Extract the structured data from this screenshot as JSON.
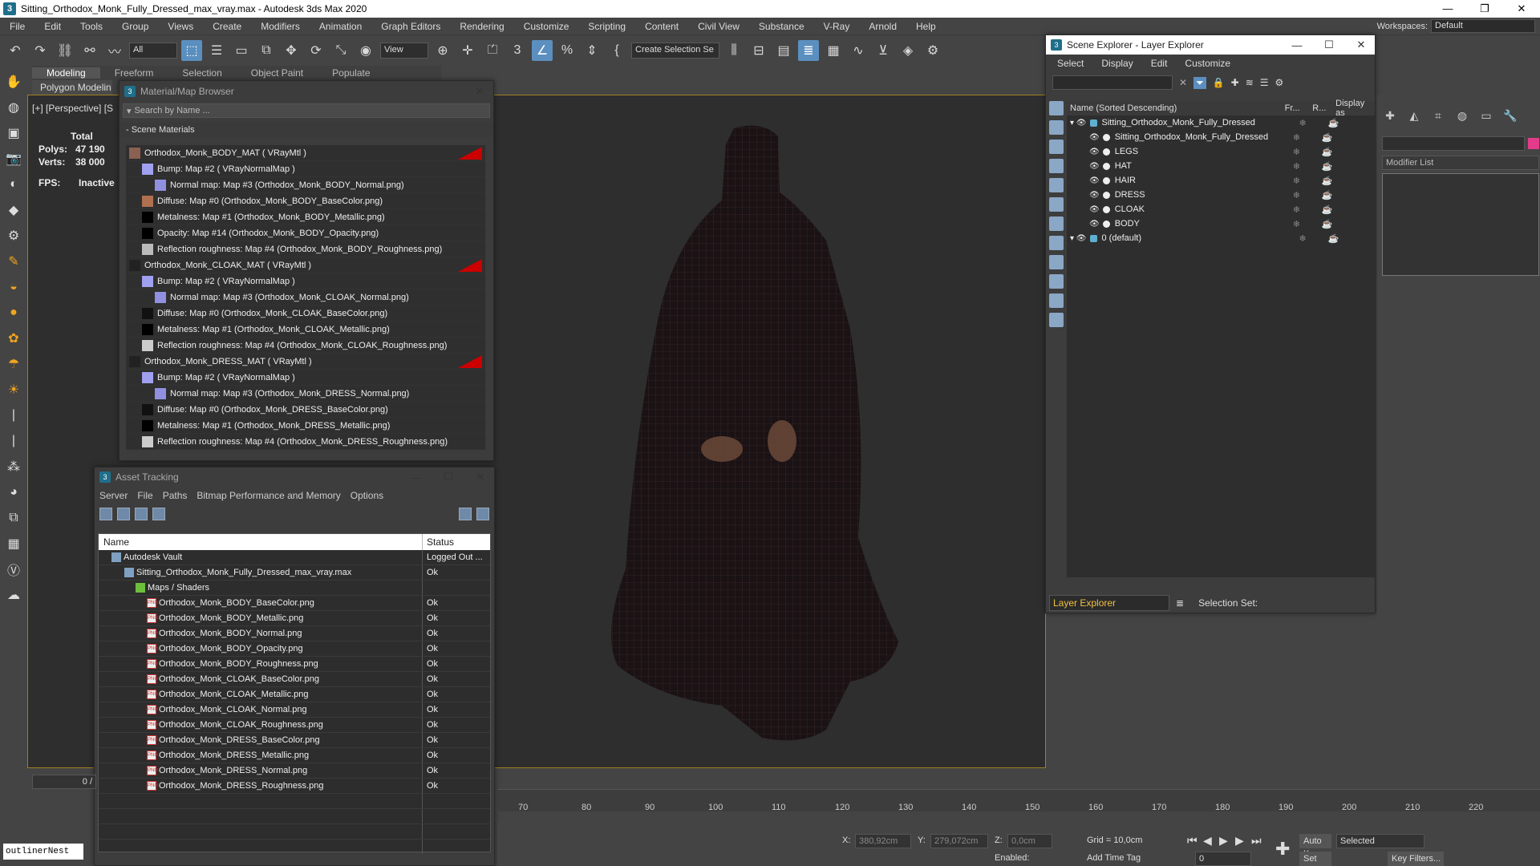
{
  "window": {
    "title": "Sitting_Orthodox_Monk_Fully_Dressed_max_vray.max - Autodesk 3ds Max 2020",
    "minimize": "—",
    "restore": "❐",
    "close": "✕"
  },
  "menu": [
    "File",
    "Edit",
    "Tools",
    "Group",
    "Views",
    "Create",
    "Modifiers",
    "Animation",
    "Graph Editors",
    "Rendering",
    "Customize",
    "Scripting",
    "Content",
    "Civil View",
    "Substance",
    "V-Ray",
    "Arnold",
    "Help"
  ],
  "workspaces": {
    "label": "Workspaces:",
    "value": "Default"
  },
  "toolbar": {
    "filter": "All",
    "view": "View",
    "selection_set": "Create Selection Se"
  },
  "ribbon": {
    "tabs": [
      "Modeling",
      "Freeform",
      "Selection",
      "Object Paint",
      "Populate"
    ],
    "sub": "Polygon Modelin"
  },
  "viewport": {
    "label": "[+] [Perspective] [S",
    "stats": {
      "total": "Total",
      "polys_label": "Polys:",
      "polys": "47 190",
      "verts_label": "Verts:",
      "verts": "38 000",
      "fps_label": "FPS:",
      "fps": "Inactive"
    }
  },
  "material_browser": {
    "title": "Material/Map Browser",
    "search_placeholder": "Search by Name ...",
    "section": "- Scene Materials",
    "rows": [
      {
        "level": 0,
        "text": "Orthodox_Monk_BODY_MAT  ( VRayMtl )",
        "swatch": "#8a6050",
        "red": true
      },
      {
        "level": 1,
        "text": "Bump: Map #2  ( VRayNormalMap )",
        "swatch": "#a0a0f0"
      },
      {
        "level": 2,
        "text": "Normal map: Map #3 (Orthodox_Monk_BODY_Normal.png)",
        "swatch": "#9090e0"
      },
      {
        "level": 1,
        "text": "Diffuse: Map #0 (Orthodox_Monk_BODY_BaseColor.png)",
        "swatch": "#b07050"
      },
      {
        "level": 1,
        "text": "Metalness: Map #1 (Orthodox_Monk_BODY_Metallic.png)",
        "swatch": "#000000"
      },
      {
        "level": 1,
        "text": "Opacity: Map #14 (Orthodox_Monk_BODY_Opacity.png)",
        "swatch": "#000000"
      },
      {
        "level": 1,
        "text": "Reflection roughness: Map #4 (Orthodox_Monk_BODY_Roughness.png)",
        "swatch": "#bbbbbb"
      },
      {
        "level": 0,
        "text": "Orthodox_Monk_CLOAK_MAT  ( VRayMtl )",
        "swatch": "#222222",
        "red": true
      },
      {
        "level": 1,
        "text": "Bump: Map #2  ( VRayNormalMap )",
        "swatch": "#a0a0f0"
      },
      {
        "level": 2,
        "text": "Normal map: Map #3 (Orthodox_Monk_CLOAK_Normal.png)",
        "swatch": "#9090e0"
      },
      {
        "level": 1,
        "text": "Diffuse: Map #0 (Orthodox_Monk_CLOAK_BaseColor.png)",
        "swatch": "#111111"
      },
      {
        "level": 1,
        "text": "Metalness: Map #1 (Orthodox_Monk_CLOAK_Metallic.png)",
        "swatch": "#000000"
      },
      {
        "level": 1,
        "text": "Reflection roughness: Map #4 (Orthodox_Monk_CLOAK_Roughness.png)",
        "swatch": "#cccccc"
      },
      {
        "level": 0,
        "text": "Orthodox_Monk_DRESS_MAT  ( VRayMtl )",
        "swatch": "#222222",
        "red": true
      },
      {
        "level": 1,
        "text": "Bump: Map #2  ( VRayNormalMap )",
        "swatch": "#a0a0f0"
      },
      {
        "level": 2,
        "text": "Normal map: Map #3 (Orthodox_Monk_DRESS_Normal.png)",
        "swatch": "#9090e0"
      },
      {
        "level": 1,
        "text": "Diffuse: Map #0 (Orthodox_Monk_DRESS_BaseColor.png)",
        "swatch": "#111111"
      },
      {
        "level": 1,
        "text": "Metalness: Map #1 (Orthodox_Monk_DRESS_Metallic.png)",
        "swatch": "#000000"
      },
      {
        "level": 1,
        "text": "Reflection roughness: Map #4 (Orthodox_Monk_DRESS_Roughness.png)",
        "swatch": "#cccccc"
      }
    ]
  },
  "asset_tracking": {
    "title": "Asset Tracking",
    "menu": [
      "Server",
      "File",
      "Paths",
      "Bitmap Performance and Memory",
      "Options"
    ],
    "col_name": "Name",
    "col_status": "Status",
    "rows": [
      {
        "indent": 16,
        "name": "Autodesk Vault",
        "status": "Logged Out ...",
        "kind": "vault"
      },
      {
        "indent": 32,
        "name": "Sitting_Orthodox_Monk_Fully_Dressed_max_vray.max",
        "status": "Ok",
        "kind": "max"
      },
      {
        "indent": 46,
        "name": "Maps / Shaders",
        "status": "",
        "kind": "folder"
      },
      {
        "indent": 60,
        "name": "Orthodox_Monk_BODY_BaseColor.png",
        "status": "Ok",
        "kind": "png"
      },
      {
        "indent": 60,
        "name": "Orthodox_Monk_BODY_Metallic.png",
        "status": "Ok",
        "kind": "png"
      },
      {
        "indent": 60,
        "name": "Orthodox_Monk_BODY_Normal.png",
        "status": "Ok",
        "kind": "png"
      },
      {
        "indent": 60,
        "name": "Orthodox_Monk_BODY_Opacity.png",
        "status": "Ok",
        "kind": "png"
      },
      {
        "indent": 60,
        "name": "Orthodox_Monk_BODY_Roughness.png",
        "status": "Ok",
        "kind": "png"
      },
      {
        "indent": 60,
        "name": "Orthodox_Monk_CLOAK_BaseColor.png",
        "status": "Ok",
        "kind": "png"
      },
      {
        "indent": 60,
        "name": "Orthodox_Monk_CLOAK_Metallic.png",
        "status": "Ok",
        "kind": "png"
      },
      {
        "indent": 60,
        "name": "Orthodox_Monk_CLOAK_Normal.png",
        "status": "Ok",
        "kind": "png"
      },
      {
        "indent": 60,
        "name": "Orthodox_Monk_CLOAK_Roughness.png",
        "status": "Ok",
        "kind": "png"
      },
      {
        "indent": 60,
        "name": "Orthodox_Monk_DRESS_BaseColor.png",
        "status": "Ok",
        "kind": "png"
      },
      {
        "indent": 60,
        "name": "Orthodox_Monk_DRESS_Metallic.png",
        "status": "Ok",
        "kind": "png"
      },
      {
        "indent": 60,
        "name": "Orthodox_Monk_DRESS_Normal.png",
        "status": "Ok",
        "kind": "png"
      },
      {
        "indent": 60,
        "name": "Orthodox_Monk_DRESS_Roughness.png",
        "status": "Ok",
        "kind": "png"
      }
    ]
  },
  "scene_explorer": {
    "title": "Scene Explorer - Layer Explorer",
    "menu": [
      "Select",
      "Display",
      "Edit",
      "Customize"
    ],
    "col_name": "Name (Sorted Descending)",
    "col_fr": "Fr...",
    "col_r": "R...",
    "col_disp": "Display as",
    "rows": [
      {
        "indent": 4,
        "name": "Sitting_Orthodox_Monk_Fully_Dressed",
        "layer": true
      },
      {
        "indent": 28,
        "name": "Sitting_Orthodox_Monk_Fully_Dressed",
        "layer": false
      },
      {
        "indent": 28,
        "name": "LEGS",
        "layer": false
      },
      {
        "indent": 28,
        "name": "HAT",
        "layer": false
      },
      {
        "indent": 28,
        "name": "HAIR",
        "layer": false
      },
      {
        "indent": 28,
        "name": "DRESS",
        "layer": false
      },
      {
        "indent": 28,
        "name": "CLOAK",
        "layer": false
      },
      {
        "indent": 28,
        "name": "BODY",
        "layer": false
      },
      {
        "indent": 4,
        "name": "0 (default)",
        "layer": true
      }
    ],
    "footer_label": "Layer Explorer",
    "selection_set": "Selection Set:"
  },
  "command_panel": {
    "modifier_list": "Modifier List",
    "obj_color": "#e33b8a"
  },
  "timeline": {
    "frame": "0 /",
    "ticks": [
      "70",
      "80",
      "90",
      "100",
      "110",
      "120",
      "130",
      "140",
      "150",
      "160",
      "170",
      "180",
      "190",
      "200",
      "210",
      "220"
    ]
  },
  "statusbar": {
    "x_label": "X:",
    "x": "380,92cm",
    "y_label": "Y:",
    "y": "279,072cm",
    "z_label": "Z:",
    "z": "0,0cm",
    "grid": "Grid = 10,0cm",
    "enabled": "Enabled:",
    "add_time_tag": "Add Time Tag",
    "auto_key": "Auto Key",
    "selected": "Selected",
    "set_key": "Set Key",
    "key_filters": "Key Filters...",
    "frame_field": "0"
  },
  "outliner": "outlinerNest"
}
